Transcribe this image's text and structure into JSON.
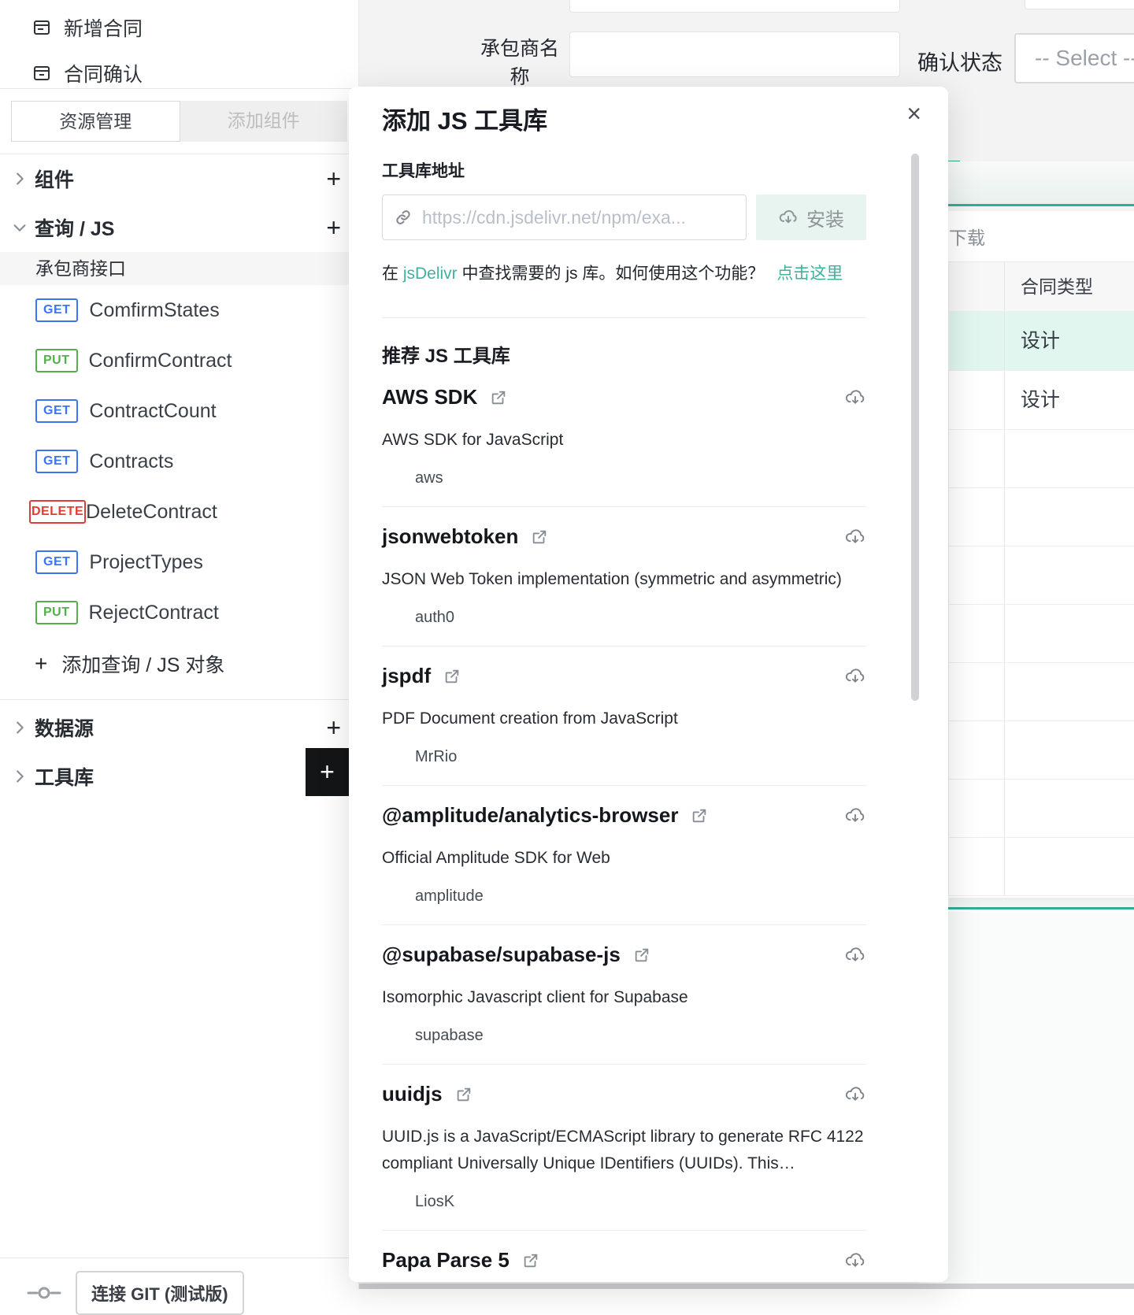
{
  "icons": {
    "plus": "+",
    "close": "×"
  },
  "colors": {
    "accent_teal": "#2fae92",
    "link_teal": "#3db39c",
    "method_get": "#3d74f6",
    "method_put": "#55ae4b",
    "method_delete": "#e23c38",
    "row_highlight": "#e0f6ee",
    "install_bg": "#e7f4ef"
  },
  "sidebar": {
    "menu_items": [
      {
        "label": "新增合同"
      },
      {
        "label": "合同确认"
      }
    ],
    "tabs": {
      "active": "资源管理",
      "inactive": "添加组件"
    },
    "tree": {
      "components_label": "组件",
      "query_js_label": "查询 / JS",
      "group_label": "承包商接口",
      "apis": [
        {
          "method": "GET",
          "name": "ComfirmStates"
        },
        {
          "method": "PUT",
          "name": "ConfirmContract"
        },
        {
          "method": "GET",
          "name": "ContractCount"
        },
        {
          "method": "GET",
          "name": "Contracts"
        },
        {
          "method": "DELETE",
          "name": "DeleteContract"
        },
        {
          "method": "GET",
          "name": "ProjectTypes"
        },
        {
          "method": "PUT",
          "name": "RejectContract"
        }
      ],
      "add_query_label": "添加查询 / JS 对象",
      "datasource_label": "数据源",
      "library_label": "工具库"
    },
    "git_button_label": "连接 GIT (测试版)"
  },
  "canvas": {
    "contractor_name_label": "承包商名称",
    "confirm_state_label": "确认状态",
    "select_placeholder": "-- Select --",
    "download_label": "下载",
    "table": {
      "type_header": "合同类型",
      "rows": [
        {
          "type": "设计",
          "highlighted": true
        },
        {
          "type": "设计",
          "highlighted": false
        }
      ]
    }
  },
  "modal": {
    "title": "添加 JS 工具库",
    "url_label": "工具库地址",
    "url_placeholder": "https://cdn.jsdelivr.net/npm/exa...",
    "install_label": "安装",
    "help": {
      "prefix": "在 ",
      "link_jsdelivr": "jsDelivr",
      "middle": " 中查找需要的 js 库。如何使用这个功能？",
      "link_here": "点击这里"
    },
    "recommended_title": "推荐 JS 工具库",
    "libraries": [
      {
        "name": "AWS SDK",
        "description": "AWS SDK for JavaScript",
        "author": "aws"
      },
      {
        "name": "jsonwebtoken",
        "description": "JSON Web Token implementation (symmetric and asymmetric)",
        "author": "auth0"
      },
      {
        "name": "jspdf",
        "description": "PDF Document creation from JavaScript",
        "author": "MrRio"
      },
      {
        "name": "@amplitude/analytics-browser",
        "description": "Official Amplitude SDK for Web",
        "author": "amplitude"
      },
      {
        "name": "@supabase/supabase-js",
        "description": "Isomorphic Javascript client for Supabase",
        "author": "supabase"
      },
      {
        "name": "uuidjs",
        "description": "UUID.js is a JavaScript/ECMAScript library to generate RFC 4122 compliant Universally Unique IDentifiers (UUIDs). This…",
        "author": "LiosK"
      },
      {
        "name": "Papa Parse 5",
        "description": "",
        "author": ""
      }
    ]
  }
}
